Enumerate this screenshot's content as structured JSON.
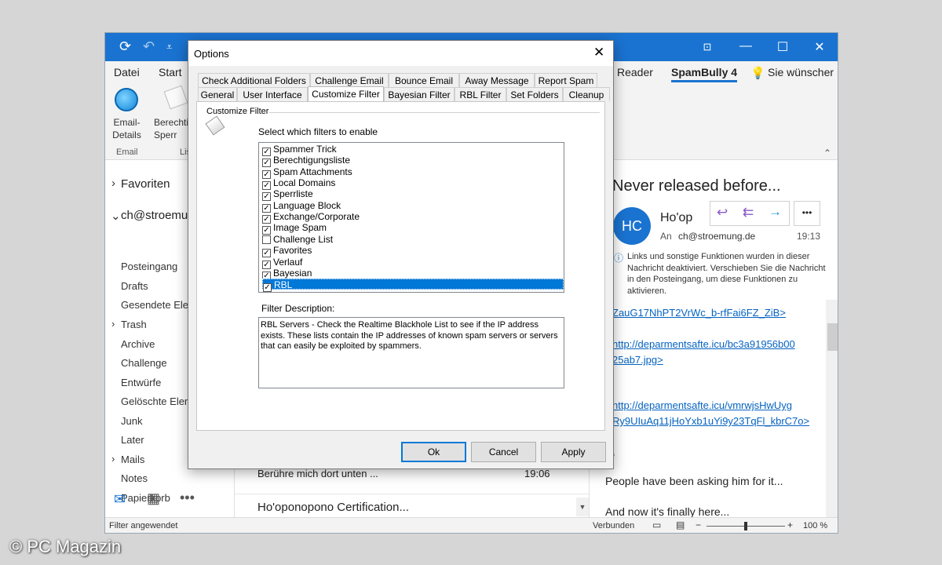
{
  "outlook": {
    "menu": [
      "Datei",
      "Start"
    ],
    "menu_right": {
      "reader": "Reader",
      "spambully": "SpamBully 4",
      "search": "Sie wünscher"
    },
    "ribbon": {
      "email_details": "Email-\nDetails",
      "email_group": "Email",
      "berechtigung": "Berechti\nSperr",
      "group2": "Lis"
    },
    "folders": {
      "favoriten": "Favoriten",
      "account": "ch@stroemun",
      "items": [
        "Posteingang",
        "Drafts",
        "Gesendete Elem",
        "Trash",
        "Archive",
        "Challenge",
        "Entwürfe",
        "Gelöschte Eleme",
        "Junk",
        "Later",
        "Mails",
        "Notes",
        "Papierkorb"
      ]
    },
    "messages": [
      {
        "subject": "Berühre mich dort unten ...",
        "time": "19:06"
      },
      {
        "subject": "Ho'oponopono Certification..."
      }
    ],
    "reading": {
      "subject": "Never released before...",
      "avatar": "HC",
      "sender": "Ho'op",
      "to_label": "An",
      "to": "ch@stroemung.de",
      "time": "19:13",
      "info": "Links und sonstige Funktionen wurden in dieser Nachricht deaktiviert. Verschieben Sie die Nachricht in den Posteingang, um diese Funktionen zu aktivieren.",
      "links": [
        "ZauG17NhPT2VrWc_b-rfFai6FZ_ZiB>",
        "http://deparmentsafte.icu/bc3a91956b00",
        "25ab7.jpg>",
        "http://deparmentsafte.icu/vmrwjsHwUyg",
        "Ry9UIuAq11jHoYxb1uYi9y23TqFl_kbrC7o>"
      ],
      "body1": "People have been asking him for it...",
      "body2": "And now it's finally here..."
    },
    "status": {
      "left": "Filter angewendet",
      "connected": "Verbunden",
      "zoom": "100 %"
    }
  },
  "dialog": {
    "title": "Options",
    "tabs_row1": [
      "Check Additional Folders",
      "Challenge Email",
      "Bounce Email",
      "Away Message",
      "Report Spam"
    ],
    "tabs_row2": [
      "General",
      "User Interface",
      "Customize Filter",
      "Bayesian Filter",
      "RBL Filter",
      "Set Folders",
      "Cleanup"
    ],
    "active_tab": "Customize Filter",
    "section": "Customize Filter",
    "prompt": "Select which filters to enable",
    "filters": [
      {
        "label": "Spammer Trick",
        "checked": true
      },
      {
        "label": "Berechtigungsliste",
        "checked": true
      },
      {
        "label": "Spam Attachments",
        "checked": true
      },
      {
        "label": "Local Domains",
        "checked": true
      },
      {
        "label": "Sperrliste",
        "checked": true
      },
      {
        "label": "Language Block",
        "checked": true
      },
      {
        "label": "Exchange/Corporate",
        "checked": true
      },
      {
        "label": "Image Spam",
        "checked": true
      },
      {
        "label": "Challenge List",
        "checked": false
      },
      {
        "label": "Favorites",
        "checked": true
      },
      {
        "label": "Verlauf",
        "checked": true
      },
      {
        "label": "Bayesian",
        "checked": true
      },
      {
        "label": "RBL",
        "checked": true,
        "selected": true
      }
    ],
    "description_label": "Filter Description:",
    "description": "RBL Servers - Check the Realtime Blackhole List to see if the IP address exists. These lists contain the IP addresses of known spam servers or servers that can easily be exploited by spammers.",
    "buttons": {
      "ok": "Ok",
      "cancel": "Cancel",
      "apply": "Apply"
    }
  },
  "watermark": "© PC Magazin",
  "colors": {
    "titlebar": "#1a73d0",
    "accent": "#0078d7",
    "link": "#0563c1"
  }
}
